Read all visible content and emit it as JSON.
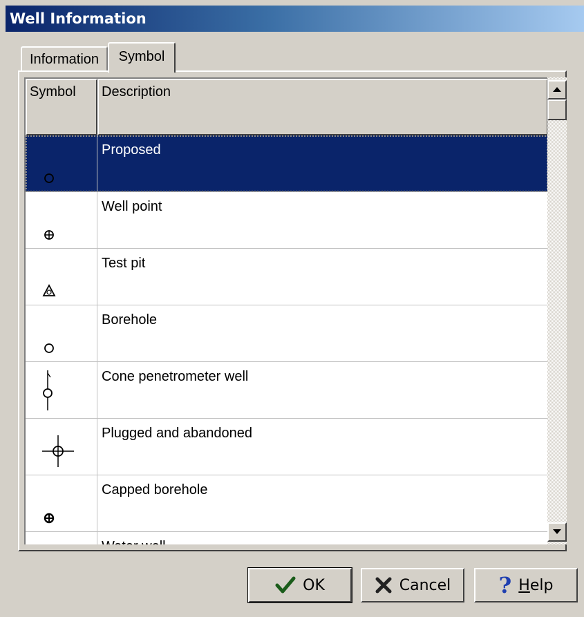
{
  "window": {
    "title": "Well Information"
  },
  "tabs": [
    {
      "label": "Information"
    },
    {
      "label": "Symbol"
    }
  ],
  "grid": {
    "columns": [
      "Symbol",
      "Description"
    ],
    "rows": [
      {
        "symbol_icon": "small-circle-icon",
        "description": "Proposed",
        "selected": true
      },
      {
        "symbol_icon": "circle-plus-icon",
        "description": "Well point"
      },
      {
        "symbol_icon": "triangle-icon",
        "description": "Test pit"
      },
      {
        "symbol_icon": "circle-icon",
        "description": "Borehole"
      },
      {
        "symbol_icon": "circle-vertical-line-icon",
        "description": "Cone penetrometer well"
      },
      {
        "symbol_icon": "crosshair-circle-icon",
        "description": "Plugged and abandoned"
      },
      {
        "symbol_icon": "circle-plus-bold-icon",
        "description": "Capped borehole"
      },
      {
        "symbol_icon": "well-icon",
        "description": "Water well"
      }
    ]
  },
  "buttons": {
    "ok": {
      "label": "OK",
      "icon": "checkmark-icon"
    },
    "cancel": {
      "label": "Cancel",
      "icon": "x-icon"
    },
    "help": {
      "label_hotkey": "H",
      "label_rest": "elp",
      "icon": "question-icon"
    }
  },
  "colors": {
    "selection": "#0a246a",
    "title_start": "#0a246a",
    "title_end": "#a6caf0",
    "face": "#d4d0c8"
  }
}
